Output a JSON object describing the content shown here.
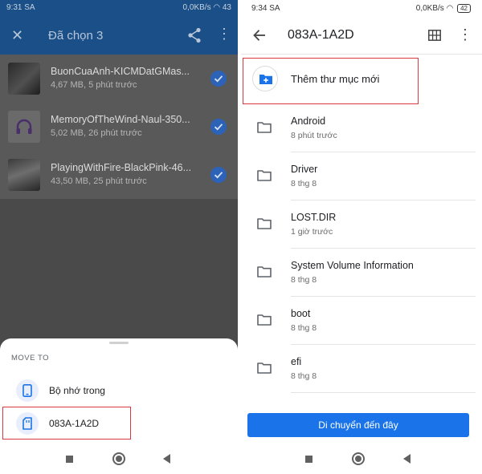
{
  "left": {
    "status": {
      "time": "9:31 SA",
      "net": "0,0KB/s",
      "battery": "43"
    },
    "appbar": {
      "title": "Đã chọn 3"
    },
    "files": [
      {
        "name": "BuonCuaAnh-KICMDatGMas...",
        "meta": "4,67 MB, 5 phút trước",
        "thumb": "album-art"
      },
      {
        "name": "MemoryOfTheWind-Naul-350...",
        "meta": "5,02 MB, 26 phút trước",
        "thumb": "headphones-icon"
      },
      {
        "name": "PlayingWithFire-BlackPink-46...",
        "meta": "43,50 MB, 25 phút trước",
        "thumb": "album-art"
      }
    ],
    "sheet": {
      "heading": "MOVE TO",
      "options": [
        {
          "label": "Bộ nhớ trong",
          "icon": "phone-storage-icon"
        },
        {
          "label": "083A-1A2D",
          "icon": "sd-card-icon"
        }
      ]
    }
  },
  "right": {
    "status": {
      "time": "9:34 SA",
      "net": "0,0KB/s",
      "battery": "42"
    },
    "appbar": {
      "title": "083A-1A2D"
    },
    "new_folder": {
      "label": "Thêm thư mục mới"
    },
    "folders": [
      {
        "name": "Android",
        "meta": "8 phút trước"
      },
      {
        "name": "Driver",
        "meta": "8 thg 8"
      },
      {
        "name": "LOST.DIR",
        "meta": "1 giờ trước"
      },
      {
        "name": "System Volume Information",
        "meta": "8 thg 8"
      },
      {
        "name": "boot",
        "meta": "8 thg 8"
      },
      {
        "name": "efi",
        "meta": "8 thg 8"
      }
    ],
    "move_button": {
      "label": "Di chuyển đến đây"
    }
  },
  "colors": {
    "accent": "#1a73e8",
    "appbar_dim": "#1a4f87",
    "highlight": "#d9383f"
  }
}
